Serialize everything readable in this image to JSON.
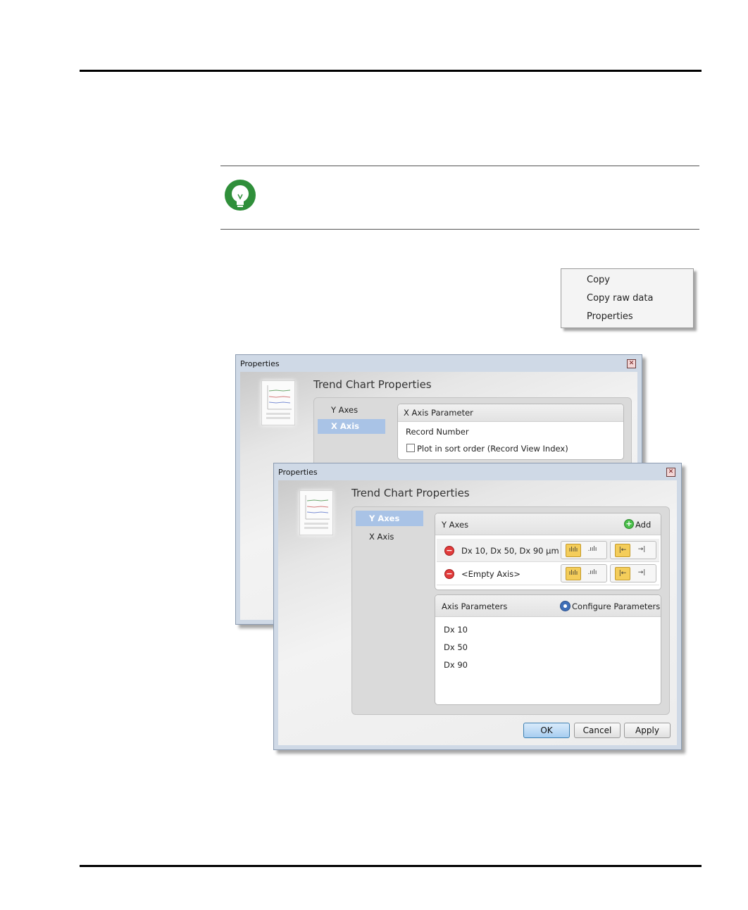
{
  "context_menu": {
    "items": [
      "Copy",
      "Copy raw data",
      "Properties"
    ]
  },
  "back_dialog": {
    "title": "Properties",
    "heading": "Trend Chart Properties",
    "nav": [
      "Y Axes",
      "X Axis"
    ],
    "selected_nav": "X Axis",
    "group_title": "X Axis Parameter",
    "parameter_value": "Record Number",
    "checkbox_label": "Plot in sort order (Record View Index)"
  },
  "front_dialog": {
    "title": "Properties",
    "heading": "Trend Chart Properties",
    "nav": [
      "Y Axes",
      "X Axis"
    ],
    "selected_nav": "Y Axes",
    "y_axes": {
      "title": "Y Axes",
      "add_label": "Add",
      "rows": [
        "Dx 10, Dx 50, Dx 90 µm",
        "<Empty Axis>"
      ]
    },
    "axis_parameters": {
      "title": "Axis Parameters",
      "configure_label": "Configure Parameters",
      "items": [
        "Dx 10",
        "Dx 50",
        "Dx 90"
      ]
    },
    "buttons": {
      "ok": "OK",
      "cancel": "Cancel",
      "apply": "Apply"
    }
  }
}
